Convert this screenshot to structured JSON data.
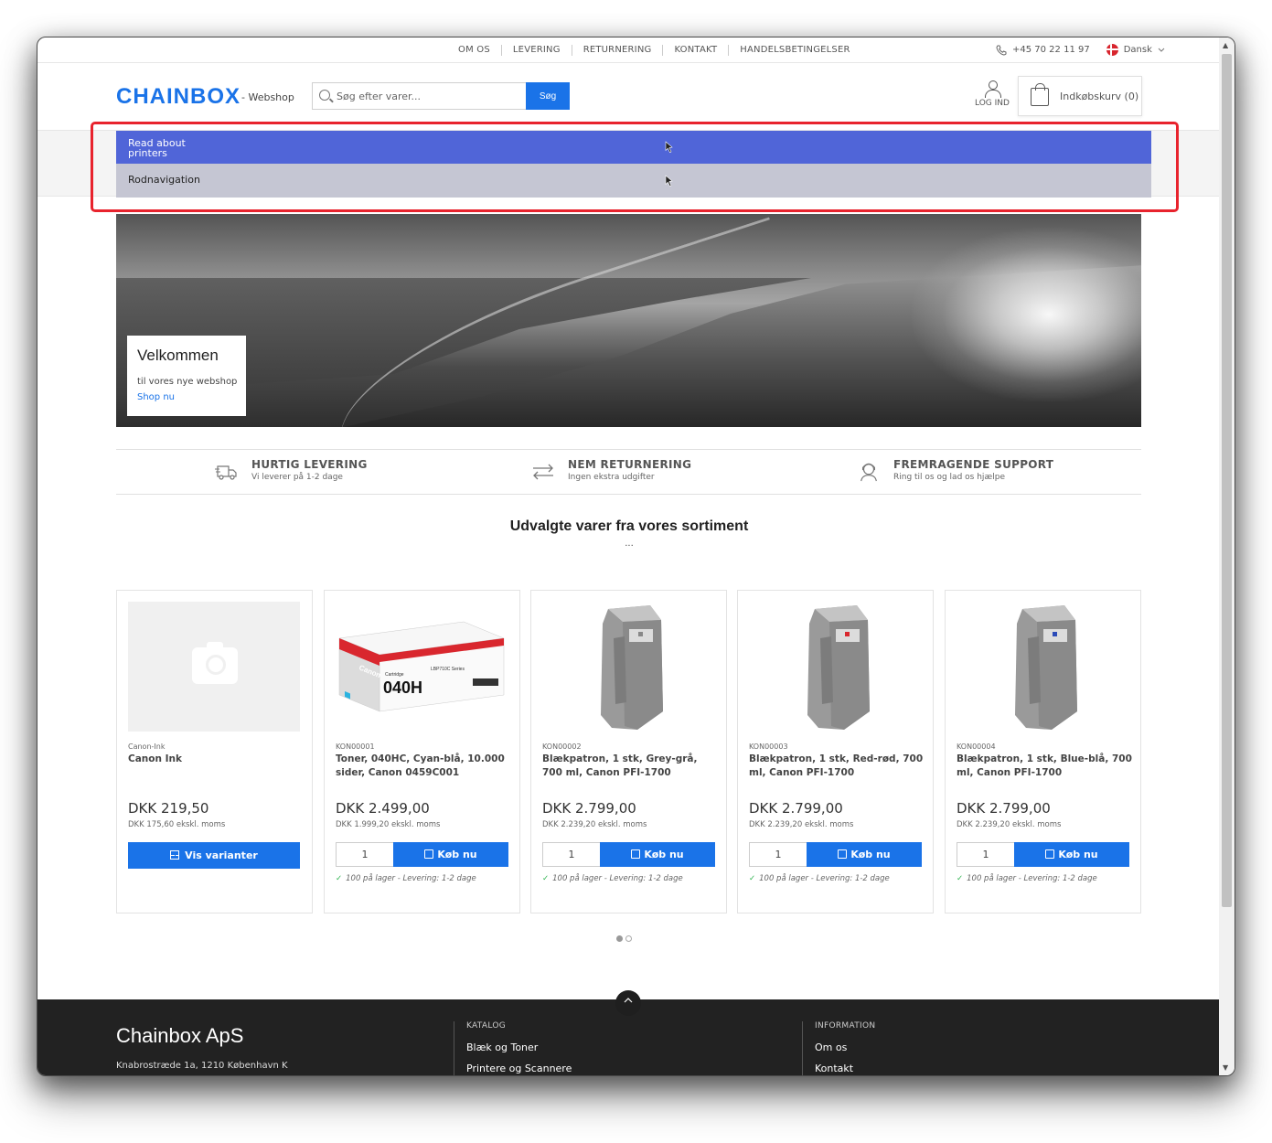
{
  "topbar": {
    "nav": [
      "OM OS",
      "LEVERING",
      "RETURNERING",
      "KONTAKT",
      "HANDELSBETINGELSER"
    ],
    "phone": "+45 70 22 11 97",
    "language": "Dansk"
  },
  "header": {
    "logo": "CHAINBOX",
    "logo_sub": "- Webshop",
    "search_placeholder": "Søg efter varer...",
    "search_button": "Søg",
    "login": "LOG IND",
    "cart": "Indkøbskurv (0)"
  },
  "menu": {
    "items": [
      {
        "label": "Read about printers"
      },
      {
        "label": "Rodnavigation"
      }
    ]
  },
  "hero": {
    "title": "Velkommen",
    "subtitle": "til vores nye webshop",
    "link": "Shop nu"
  },
  "usp": [
    {
      "title": "HURTIG LEVERING",
      "sub": "Vi leverer på 1-2 dage",
      "icon": "delivery-truck-icon"
    },
    {
      "title": "NEM RETURNERING",
      "sub": "Ingen ekstra udgifter",
      "icon": "return-arrows-icon"
    },
    {
      "title": "FREMRAGENDE SUPPORT",
      "sub": "Ring til os og lad os hjælpe",
      "icon": "support-headset-icon"
    }
  ],
  "featured": {
    "title": "Udvalgte varer fra vores sortiment",
    "dots": "..."
  },
  "products": [
    {
      "sku": "Canon-Ink",
      "name": "Canon Ink",
      "price": "DKK 219,50",
      "ex": "DKK 175,60 ekskl. moms",
      "button": "Vis varianter",
      "image": "placeholder"
    },
    {
      "sku": "KON00001",
      "name": "Toner, 040HC, Cyan-blå, 10.000 sider, Canon 0459C001",
      "price": "DKK 2.499,00",
      "ex": "DKK 1.999,20 ekskl. moms",
      "qty": "1",
      "button": "Køb nu",
      "stock": "100 på lager - Levering: 1-2 dage",
      "image": "toner-box"
    },
    {
      "sku": "KON00002",
      "name": "Blækpatron, 1 stk, Grey-grå, 700 ml, Canon PFI-1700",
      "price": "DKK 2.799,00",
      "ex": "DKK 2.239,20 ekskl. moms",
      "qty": "1",
      "button": "Køb nu",
      "stock": "100 på lager - Levering: 1-2 dage",
      "image": "cartridge",
      "accent": "#888888"
    },
    {
      "sku": "KON00003",
      "name": "Blækpatron, 1 stk, Red-rød, 700 ml, Canon PFI-1700",
      "price": "DKK 2.799,00",
      "ex": "DKK 2.239,20 ekskl. moms",
      "qty": "1",
      "button": "Køb nu",
      "stock": "100 på lager - Levering: 1-2 dage",
      "image": "cartridge",
      "accent": "#d9272e"
    },
    {
      "sku": "KON00004",
      "name": "Blækpatron, 1 stk, Blue-blå, 700 ml, Canon PFI-1700",
      "price": "DKK 2.799,00",
      "ex": "DKK 2.239,20 ekskl. moms",
      "qty": "1",
      "button": "Køb nu",
      "stock": "100 på lager - Levering: 1-2 dage",
      "image": "cartridge",
      "accent": "#2b4bb8"
    }
  ],
  "toner_box": {
    "brand": "Canon",
    "small": "Cartridge",
    "code": "040H",
    "series": "LBP710C Series"
  },
  "footer": {
    "company": "Chainbox ApS",
    "address": "Knabrostræde 1a, 1210 København K",
    "catalog_heading": "KATALOG",
    "catalog_links": [
      "Blæk og Toner",
      "Printere og Scannere"
    ],
    "info_heading": "INFORMATION",
    "info_links": [
      "Om os",
      "Kontakt"
    ]
  },
  "colors": {
    "brand": "#1a73e8",
    "menu_active": "#5065d8",
    "menu_second": "#c5c6d3",
    "highlight": "#e8232d",
    "footer": "#222222"
  }
}
